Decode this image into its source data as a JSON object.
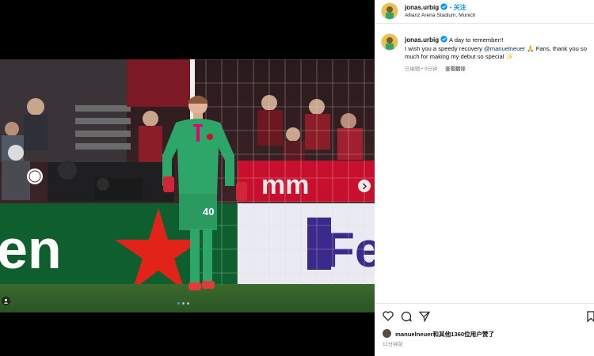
{
  "post": {
    "username": "jonas.urbig",
    "location": "Allianz Arena Stadium, Munich",
    "follow_label": "关注",
    "dot": "•",
    "caption_line1": "A day to remember!!",
    "caption_line2_a": "I wish you a speedy recovery",
    "caption_mention": "@manuelneuer",
    "caption_line2_b": "🙏 Fans, thank you so much for making my debut so special ✨",
    "edited_label": "已编辑",
    "caption_age": "9分钟",
    "see_translation": "查看翻译",
    "likes_text": "manuelneuer和其他1360位用户赞了",
    "post_age": "11分钟前"
  },
  "photo": {
    "jersey_number": "40",
    "board_text_left": "en",
    "board_text_right": "Fe",
    "carousel_count": 3,
    "carousel_active": 0
  },
  "icons": {
    "like": "heart-icon",
    "comment": "comment-icon",
    "share": "share-icon",
    "save": "bookmark-icon",
    "next": "chevron-right-icon",
    "usertag": "user-icon"
  },
  "colors": {
    "verified": "#0095f6",
    "link": "#00376b",
    "follow": "#0095f6",
    "jersey": "#2ea66a",
    "board": "#c8102e"
  }
}
